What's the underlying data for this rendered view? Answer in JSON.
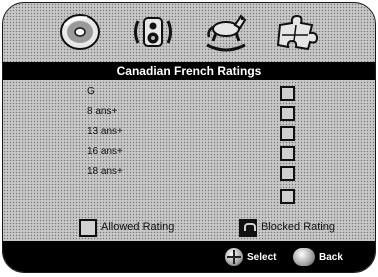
{
  "title": "Canadian French Ratings",
  "icons": [
    "disc-icon",
    "speaker-icon",
    "rocking-horse-icon",
    "puzzle-icon"
  ],
  "ratings": [
    {
      "label": "G"
    },
    {
      "label": "8 ans+"
    },
    {
      "label": "13 ans+"
    },
    {
      "label": "16 ans+"
    },
    {
      "label": "18 ans+"
    },
    {
      "label": ""
    }
  ],
  "legend": {
    "allowed": "Allowed Rating",
    "blocked": "Blocked Rating"
  },
  "footer": {
    "select": "Select",
    "back": "Back"
  }
}
